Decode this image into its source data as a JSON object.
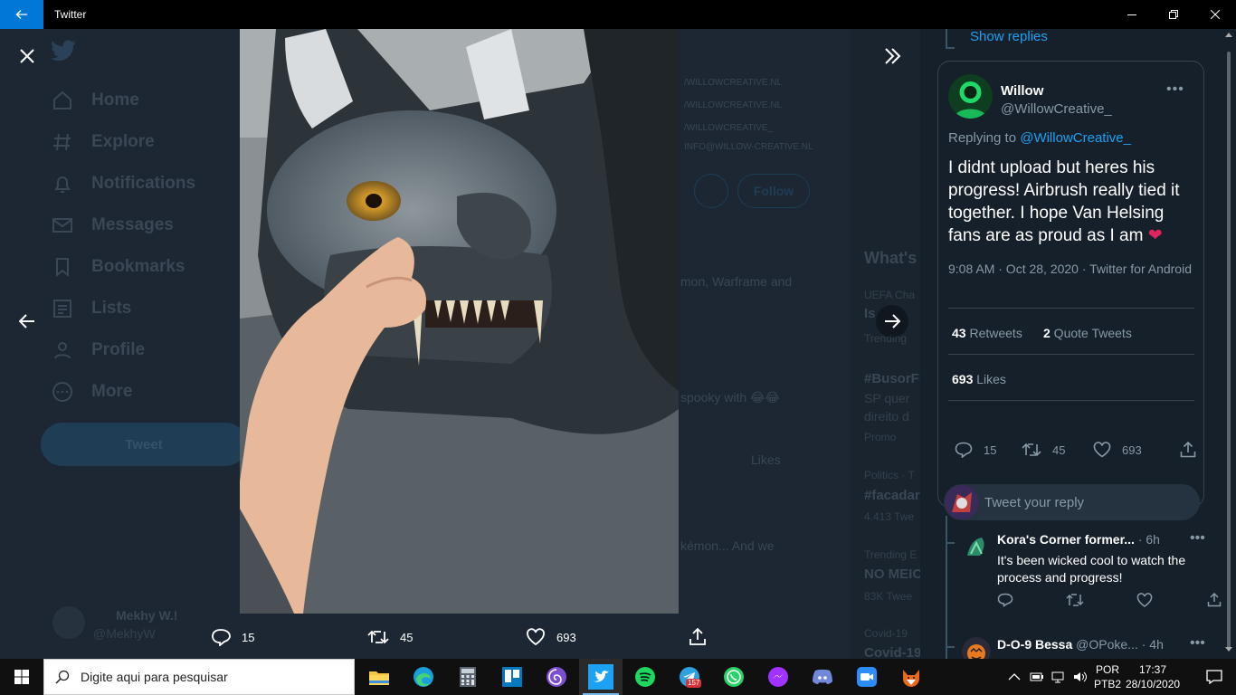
{
  "window": {
    "title": "Twitter"
  },
  "background": {
    "nav": [
      "Home",
      "Explore",
      "Notifications",
      "Messages",
      "Bookmarks",
      "Lists",
      "Profile",
      "More"
    ],
    "tweet_button": "Tweet",
    "user_name": "Mekhy W.!",
    "user_handle": "@MekhyW",
    "links": [
      "/WILLOWCREATIVE.NL",
      "/WILLOWCREATIVE.NL",
      "/WILLOWCREATIVE_",
      "INFO@WILLOW-CREATIVE.NL"
    ],
    "follow": "Follow",
    "snippet_1": "mon, Warframe and",
    "snippet_2": "spooky with 😂😂",
    "likes": "Likes",
    "snippet_3": "kémon... And we",
    "right_items": [
      "What's",
      "UEFA Cha",
      "Is",
      "Trending",
      "#BusorFi",
      "SP quer",
      "direito d",
      "Promo",
      "Politics · T",
      "#facadar",
      "4.413 Twe",
      "Trending E",
      "NO MEIC",
      "83K Twee",
      "Covid-19",
      "Covid-19"
    ]
  },
  "viewer": {
    "actions": {
      "reply_count": "15",
      "retweet_count": "45",
      "like_count": "693"
    }
  },
  "tweet": {
    "show_replies": "Show replies",
    "author_name": "Willow",
    "author_handle": "@WillowCreative_",
    "more": "•••",
    "replying_prefix": "Replying to ",
    "replying_to": "@WillowCreative_",
    "text": "I didnt upload but heres his progress! Airbrush really tied it together. I hope Van Helsing fans are as proud as I am",
    "heart": "❤",
    "timestamp": "9:08 AM · Oct 28, 2020 · Twitter for Android",
    "retweets_num": "43",
    "retweets_label": " Retweets",
    "quotes_num": "2",
    "quotes_label": " Quote Tweets",
    "likes_num": "693",
    "likes_label": " Likes",
    "reply_count": "15",
    "retweet_count": "45",
    "like_count": "693",
    "reply_placeholder": "Tweet your reply"
  },
  "replies": [
    {
      "name": "Kora's Corner former...",
      "meta": " · 6h",
      "text": "It's been wicked cool to watch the process and progress!"
    },
    {
      "name": "D-O-9 Bessa",
      "meta": " @OPoke... · 4h",
      "text": ""
    }
  ],
  "taskbar": {
    "search_placeholder": "Digite aqui para pesquisar",
    "lang_1": "POR",
    "lang_2": "PTB2",
    "time": "17:37",
    "date": "28/10/2020",
    "telegram_badge": "157"
  },
  "colors": {
    "accent": "#1da1f2",
    "panel": "#15202b",
    "like": "#e0245e"
  }
}
